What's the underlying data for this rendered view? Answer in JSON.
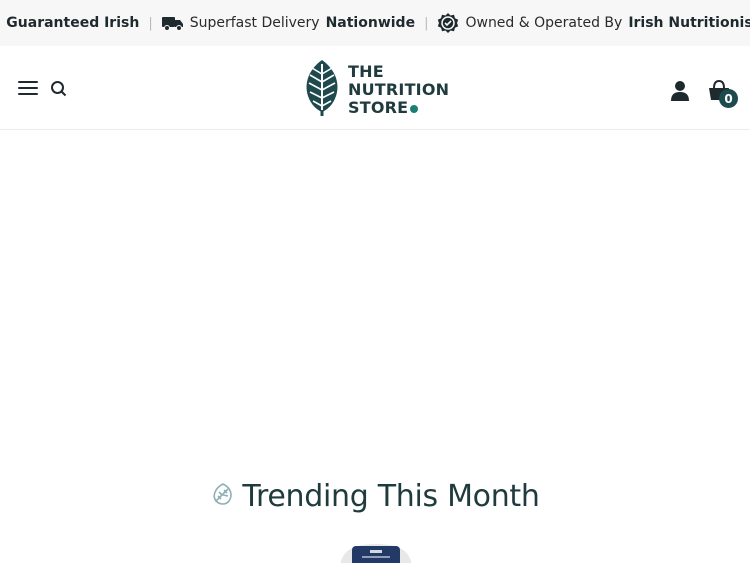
{
  "topbar": {
    "item1_bold": "Guaranteed Irish",
    "item2_normal": "Superfast Delivery",
    "item2_bold": "Nationwide",
    "item3_normal": "Owned & Operated By",
    "item3_bold": "Irish Nutritionists",
    "separator": "|"
  },
  "header": {
    "logo_line1": "THE",
    "logo_line2": "NUTRITION",
    "logo_line3": "STORE",
    "cart_count": "0"
  },
  "trending": {
    "title": "Trending This Month"
  },
  "colors": {
    "brand_dark": "#1f3b3d",
    "brand_teal": "#1a7f72",
    "badge": "#1c4a4f",
    "topbar_bg": "#f7f7f7"
  },
  "icons": {
    "guaranteed": "guaranteed-irish-icon",
    "delivery": "delivery-truck-icon",
    "seal": "seal-badge-icon",
    "menu": "hamburger-menu-icon",
    "search": "search-icon",
    "account": "account-icon",
    "cart": "shopping-basket-icon",
    "leaf": "leaf-icon"
  }
}
